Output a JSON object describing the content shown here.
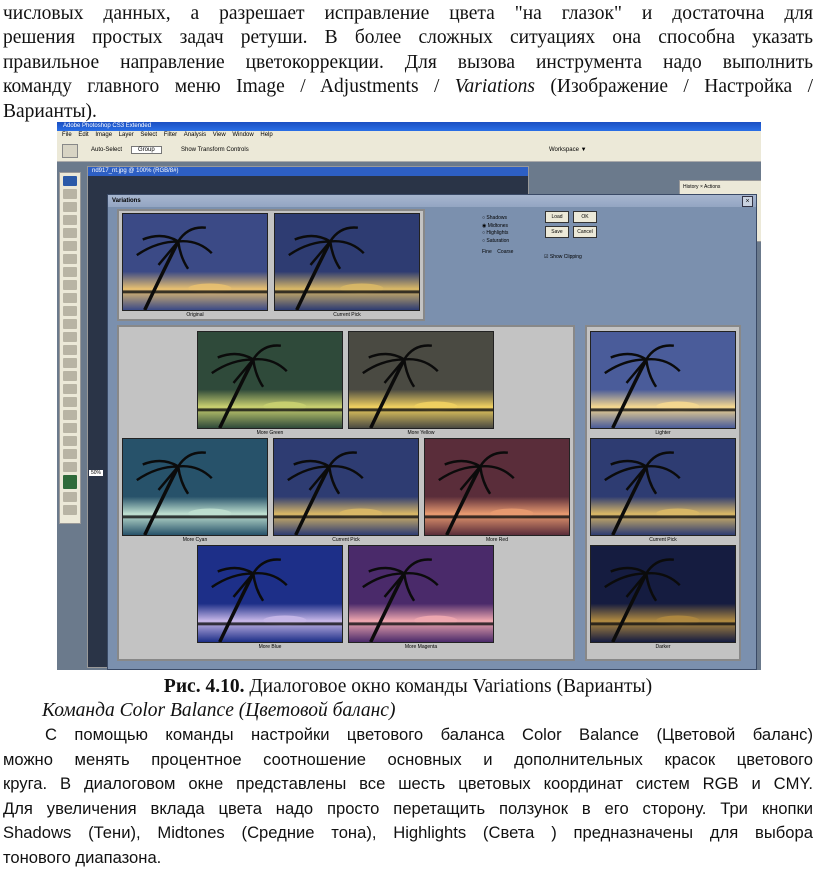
{
  "intro_lines": [
    "числовых данных, а разрешает исправление цвета \"на глазок\" и достаточна для",
    "решения простых задач ретуши. В более сложных ситуациях она способна указать",
    "правильное направление цветокоррекции. Для вызова инструмента надо выполнить",
    "команду главного меню Image / Adjustments / ",
    "Вариантs)."
  ],
  "intro_line4_italic": "Variations",
  "intro_line4_rest": " (Изображение / Настройка /",
  "intro_line5": "Варианты).",
  "screenshot": {
    "app_title": "Adobe Photoshop CS3 Extended",
    "menu": [
      "File",
      "Edit",
      "Image",
      "Layer",
      "Select",
      "Filter",
      "Analysis",
      "View",
      "Window",
      "Help"
    ],
    "option_auto_select": "Auto-Select",
    "option_group": "Group",
    "option_transform": "Show Transform Controls",
    "workspace": "Workspace ▼",
    "doc_title": "nd917_nt.jpg @ 100% (RGB/8#)",
    "zoom": "50%",
    "palette_tabs": "History × Actions",
    "dialog_title": "Variations",
    "radio_options": [
      "Shadows",
      "Midtones",
      "Highlights",
      "Saturation"
    ],
    "fine": "Fine",
    "coarse": "Coarse",
    "show_clipping": "Show Clipping",
    "buttons": {
      "load": "Load",
      "ok": "OK",
      "save": "Save",
      "cancel": "Cancel"
    },
    "top_captions": [
      "Original",
      "Current Pick"
    ],
    "center_captions": [
      "More Green",
      "More Yellow",
      "More Cyan",
      "Current Pick",
      "More Red",
      "More Blue",
      "More Magenta"
    ],
    "right_captions": [
      "Lighter",
      "Current Pick",
      "Darker"
    ]
  },
  "figure_caption_bold": "Рис. 4.10.",
  "figure_caption_text": " Диалоговое окно команды Variations (Варианты)",
  "subheading": "Команда Color Balance (Цветовой баланс)",
  "body_lines": [
    "С помощью команды настройки цветового баланса Color Balance (Цветовой баланс)",
    "можно менять процентное соотношение основных и дополнительных красок цветового",
    "круга. В диалоговом окне представлены все шесть цветовых координат систем RGB и CMY.",
    "Для увеличения вклада цвета надо просто перетащить ползунок в его сторону. Три кнопки",
    "Shadows (Тени), Midtones (Средние тона), Highlights (Света ) предназначены для выбора",
    "тонового диапазона."
  ],
  "colors": {
    "original": [
      "#3b4a86",
      "#e8c070"
    ],
    "current": [
      "#2e3c72",
      "#d9b866"
    ],
    "green": [
      "#2f4a3a",
      "#c9d070"
    ],
    "yellow": [
      "#4a4a42",
      "#f0d060"
    ],
    "cyan": [
      "#27526a",
      "#bfe0d0"
    ],
    "red": [
      "#5a2d3a",
      "#e89a70"
    ],
    "blue": [
      "#1d2f88",
      "#c8b8e8"
    ],
    "magenta": [
      "#4a2a6a",
      "#f0a8b0"
    ],
    "lighter": [
      "#4a5c9a",
      "#f5d890"
    ],
    "darker": [
      "#151c40",
      "#b08a40"
    ]
  }
}
